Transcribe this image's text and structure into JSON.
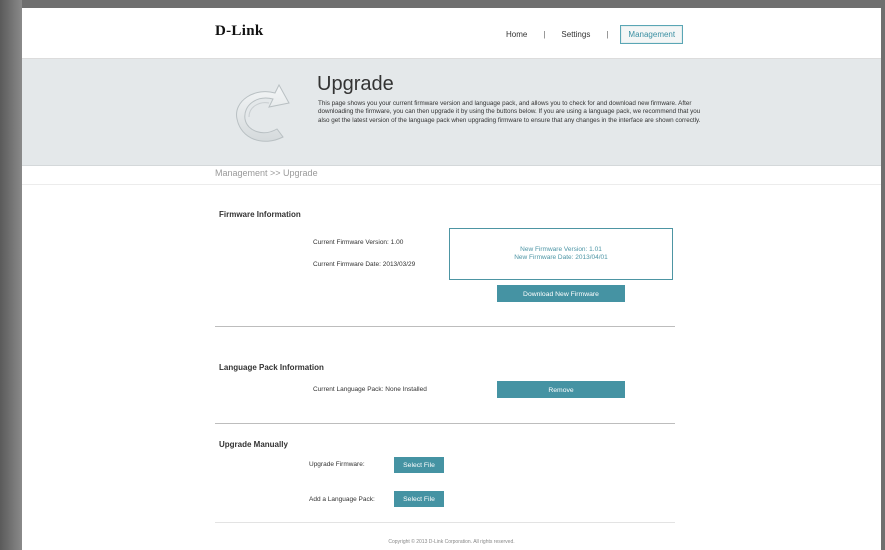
{
  "header": {
    "logo": "D-Link",
    "nav": [
      {
        "label": "Home"
      },
      {
        "label": "Settings"
      },
      {
        "label": "Management"
      }
    ]
  },
  "banner": {
    "title": "Upgrade",
    "description": "This page shows you your current firmware version and language pack, and allows you to check for and download new firmware. After downloading the firmware, you can then upgrade it by using the buttons below. If you are using a language pack, we recommend that you also get the latest version of the language pack when upgrading firmware to ensure that any changes in the interface are shown correctly."
  },
  "breadcrumb": "Management >> Upgrade",
  "firmware": {
    "section_title": "Firmware Information",
    "current_version": "Current Firmware Version: 1.00",
    "current_date": "Current Firmware Date: 2013/03/29",
    "new_version": "New Firmware Version: 1.01",
    "new_date": "New Firmware Date: 2013/04/01",
    "download_button": "Download New Firmware"
  },
  "language_pack": {
    "section_title": "Language Pack Information",
    "current": "Current Language Pack: None Installed",
    "remove_button": "Remove"
  },
  "manual": {
    "section_title": "Upgrade Manually",
    "firmware_label": "Upgrade Firmware:",
    "firmware_button": "Select File",
    "language_label": "Add a Language Pack:",
    "language_button": "Select File"
  },
  "footer": "Copyright © 2013 D-Link Corporation. All rights reserved.",
  "colors": {
    "accent": "#4593a3",
    "banner_bg": "#e4e8ea"
  },
  "icons": [
    "refresh-arrow-icon"
  ]
}
